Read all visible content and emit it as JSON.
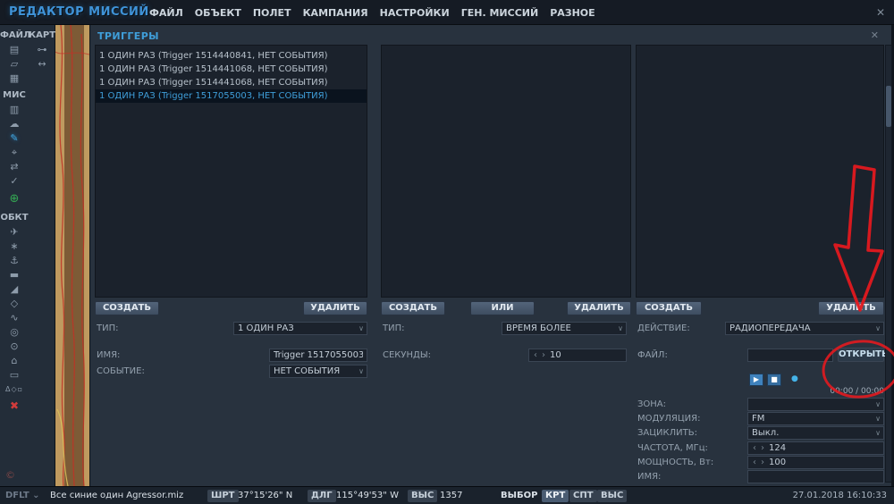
{
  "colors": {
    "accent": "#3f9ed9",
    "annotation": "#e2191f",
    "selection": "#0a131e"
  },
  "icons": {
    "close": "✕",
    "chevron_down": "∨",
    "chevron_small": "⌄",
    "stepper_left": "‹",
    "stepper_right": "›",
    "play": "▶",
    "stop": "■",
    "knob": "●",
    "copyright": "©"
  },
  "titlebar": {
    "title": "РЕДАКТОР МИССИЙ",
    "menu": [
      "ФАЙЛ",
      "ОБЪЕКТ",
      "ПОЛЕТ",
      "КАМПАНИЯ",
      "НАСТРОЙКИ",
      "ГЕН. МИССИЙ",
      "РАЗНОЕ"
    ]
  },
  "toolbar": {
    "col1_label": "ФАЙЛ",
    "col2_label": "КАРТА",
    "mis_label": "МИС",
    "obkt_label": "ОБКТ",
    "file_icons": [
      {
        "name": "new-file",
        "glyph": "▤"
      },
      {
        "name": "open-folder",
        "glyph": "▱"
      },
      {
        "name": "save",
        "glyph": "▦"
      }
    ],
    "map_icons": [
      {
        "name": "key",
        "glyph": "⊶"
      },
      {
        "name": "ruler",
        "glyph": "↔"
      }
    ],
    "mis_icons": [
      {
        "name": "clipboard",
        "glyph": "▥"
      },
      {
        "name": "weather",
        "glyph": "☁"
      },
      {
        "name": "triggers",
        "glyph": "✎"
      },
      {
        "name": "crosshair",
        "glyph": "⌖"
      },
      {
        "name": "swap",
        "glyph": "⇄"
      },
      {
        "name": "check",
        "glyph": "✓"
      }
    ],
    "add_glyph": "⊕",
    "obkt_icons": [
      {
        "name": "airplane",
        "glyph": "✈"
      },
      {
        "name": "helicopter",
        "glyph": "∗"
      },
      {
        "name": "ship",
        "glyph": "⚓"
      },
      {
        "name": "vehicle",
        "glyph": "▬"
      },
      {
        "name": "air-defense",
        "glyph": "◢"
      },
      {
        "name": "static-object",
        "glyph": "◇"
      },
      {
        "name": "route",
        "glyph": "∿"
      },
      {
        "name": "trigger-zone",
        "glyph": "◎"
      },
      {
        "name": "bullseye",
        "glyph": "⊙"
      },
      {
        "name": "farp",
        "glyph": "⌂"
      },
      {
        "name": "warehouse",
        "glyph": "▭"
      },
      {
        "name": "shapes",
        "glyph": "Δ◇▫"
      }
    ],
    "delete_glyph": "✖"
  },
  "panel": {
    "title": "ТРИГГЕРЫ",
    "triggers": {
      "items": [
        "1 ОДИН РАЗ (Trigger 1514440841, НЕТ СОБЫТИЯ)",
        "1 ОДИН РАЗ (Trigger 1514441068, НЕТ СОБЫТИЯ)",
        "1 ОДИН РАЗ (Trigger 1514441068, НЕТ СОБЫТИЯ)",
        "1 ОДИН РАЗ (Trigger 1517055003, НЕТ СОБЫТИЯ)"
      ],
      "selected_index": 3,
      "create": "СОЗДАТЬ",
      "delete": "УДАЛИТЬ",
      "type_label": "ТИП:",
      "type_value": "1 ОДИН РАЗ",
      "name_label": "ИМЯ:",
      "name_value": "Trigger 1517055003",
      "event_label": "СОБЫТИЕ:",
      "event_value": "НЕТ СОБЫТИЯ"
    },
    "conditions": {
      "create": "СОЗДАТЬ",
      "or": "ИЛИ",
      "delete": "УДАЛИТЬ",
      "type_label": "ТИП:",
      "type_value": "ВРЕМЯ БОЛЕЕ",
      "seconds_label": "СЕКУНДЫ:",
      "seconds_value": "10"
    },
    "actions": {
      "create": "СОЗДАТЬ",
      "delete": "УДАЛИТЬ",
      "action_label": "ДЕЙСТВИЕ:",
      "action_value": "РАДИОПЕРЕДАЧА",
      "file_label": "ФАЙЛ:",
      "file_value": "",
      "open_button": "ОТКРЫТЬ",
      "time_display": "00:00 / 00:00",
      "zone_label": "ЗОНА:",
      "zone_value": "",
      "modulation_label": "МОДУЛЯЦИЯ:",
      "modulation_value": "FM",
      "loop_label": "ЗАЦИКЛИТЬ:",
      "loop_value": "Выкл.",
      "frequency_label": "ЧАСТОТА, МГц:",
      "frequency_value": "124",
      "power_label": "МОЩНОСТЬ, Вт:",
      "power_value": "100",
      "name_label": "ИМЯ:",
      "name_value": ""
    }
  },
  "statusbar": {
    "mode": "DFLT",
    "file": "Все синие один Agressor.miz",
    "lat_label": "ШРТ",
    "lat": "37°15'26\" N",
    "lon_label": "ДЛГ",
    "lon": "115°49'53\" W",
    "alt_label": "ВЫС",
    "alt": "1357",
    "select_label": "ВЫБОР",
    "toggles": [
      "КРТ",
      "СПТ",
      "ВЫС"
    ],
    "datetime": "27.01.2018 16:10:33"
  }
}
